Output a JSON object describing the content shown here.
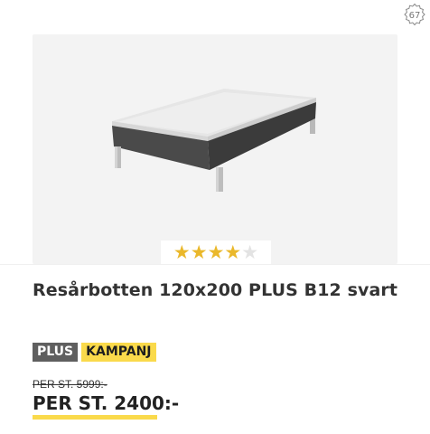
{
  "watermark": {
    "icon": "badge-seal-icon",
    "text": "67"
  },
  "product": {
    "title": "Resårbotten 120x200 PLUS B12 svart",
    "image_icon": "bed-icon",
    "rating": {
      "value": 4,
      "max": 5,
      "star_color": "#eab82b"
    },
    "badges": {
      "plus": "PLUS",
      "kampanj": "KAMPANJ"
    },
    "badge_colors": {
      "plus": "#5f5f5f",
      "kampanj": "#fada4b"
    },
    "old_price": "PER ST. 5999:-",
    "new_price": "PER ST. 2400:-"
  }
}
